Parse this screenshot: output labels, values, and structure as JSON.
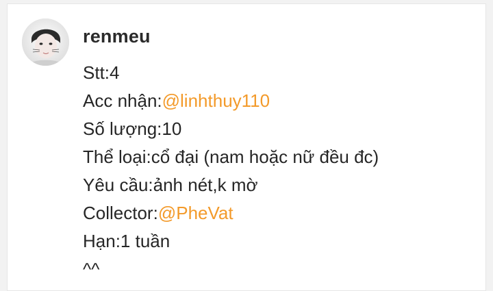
{
  "comment": {
    "username": "renmeu",
    "lines": [
      {
        "text": "Stt:4"
      },
      {
        "label": "Acc nhận:",
        "mention": "@linhthuy110"
      },
      {
        "text": "Số lượng:10"
      },
      {
        "text": "Thể loại:cổ đại (nam hoặc nữ đều đc)"
      },
      {
        "text": "Yêu cầu:ảnh nét,k mờ"
      },
      {
        "label": "Collector:",
        "mention": "@PheVat"
      },
      {
        "text": "Hạn:1 tuần"
      },
      {
        "text": "^^"
      }
    ]
  },
  "colors": {
    "mention": "#f39a2a",
    "text": "#262626",
    "background": "#ffffff"
  }
}
